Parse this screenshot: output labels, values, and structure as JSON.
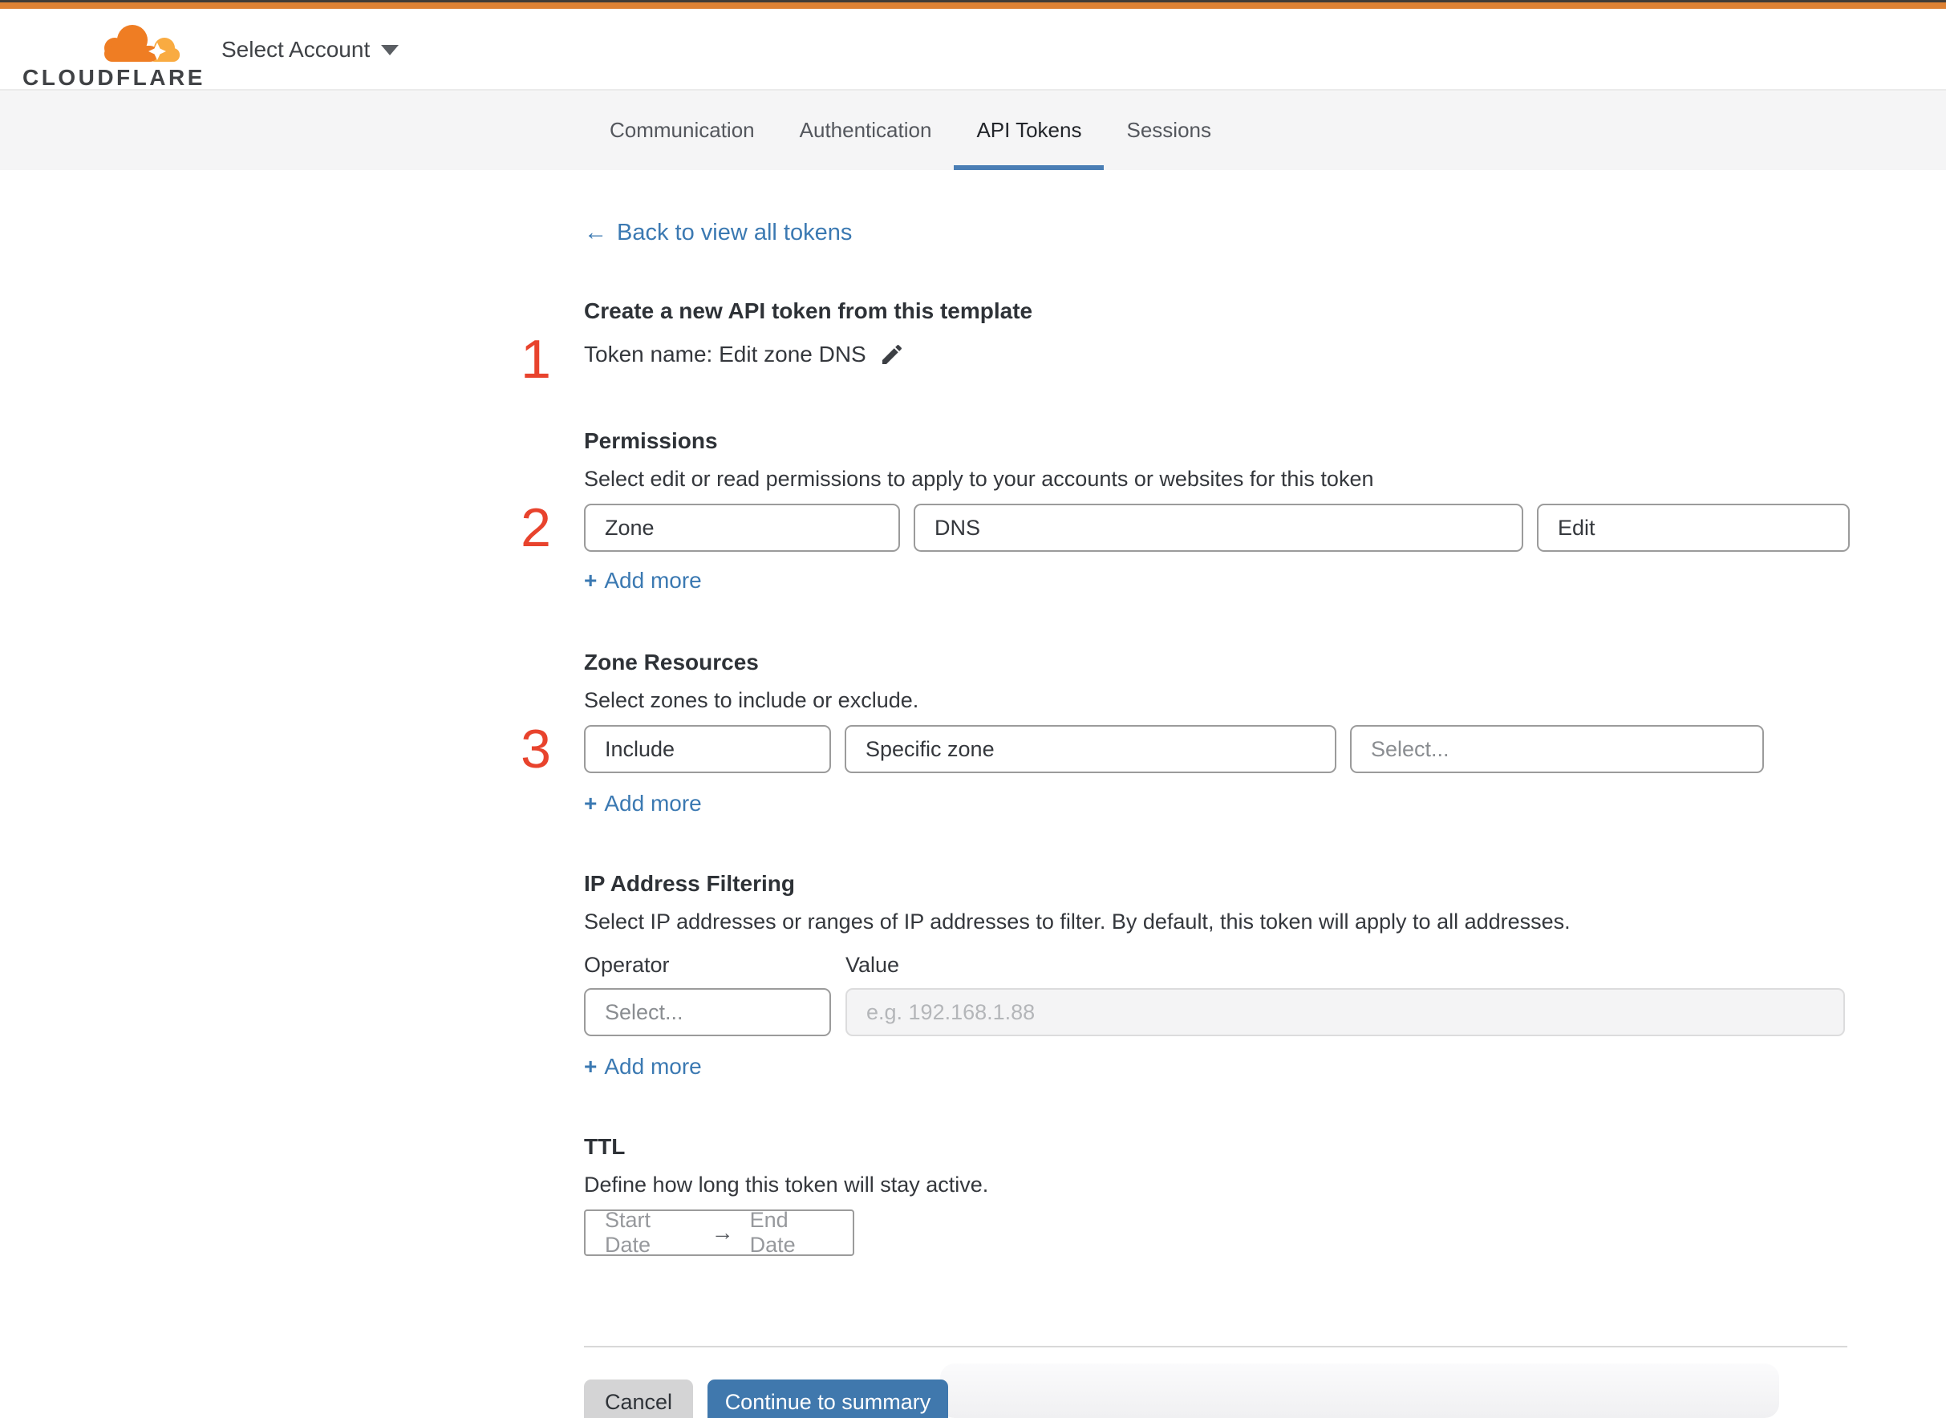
{
  "header": {
    "brand": "CLOUDFLARE",
    "account_selector": "Select Account"
  },
  "tabs": [
    {
      "label": "Communication",
      "active": false
    },
    {
      "label": "Authentication",
      "active": false
    },
    {
      "label": "API Tokens",
      "active": true
    },
    {
      "label": "Sessions",
      "active": false
    }
  ],
  "back": {
    "arrow": "←",
    "label": "Back to view all tokens"
  },
  "step1": {
    "number": "1",
    "heading": "Create a new API token from this template",
    "token_line": "Token name: Edit zone DNS"
  },
  "permissions": {
    "number": "2",
    "title": "Permissions",
    "description": "Select edit or read permissions to apply to your accounts or websites for this token",
    "type_value": "Zone",
    "item_value": "DNS",
    "level_value": "Edit"
  },
  "zone_resources": {
    "number": "3",
    "title": "Zone Resources",
    "description": "Select zones to include or exclude.",
    "mode_value": "Include",
    "scope_value": "Specific zone",
    "zone_placeholder": "Select..."
  },
  "ip_filtering": {
    "title": "IP Address Filtering",
    "description": "Select IP addresses or ranges of IP addresses to filter. By default, this token will apply to all addresses.",
    "operator_label": "Operator",
    "value_label": "Value",
    "operator_placeholder": "Select...",
    "value_placeholder": "e.g. 192.168.1.88"
  },
  "ttl": {
    "title": "TTL",
    "description": "Define how long this token will stay active.",
    "start_placeholder": "Start Date",
    "arrow": "→",
    "end_placeholder": "End Date"
  },
  "add_more": {
    "plus": "+",
    "label": "Add more"
  },
  "footer": {
    "cancel_label": "Cancel",
    "continue_label": "Continue to summary"
  },
  "colors": {
    "top_bar_orange": "#de8234",
    "brand_orange": "#ef7d23",
    "brand_orange_light": "#f9ab41",
    "link_blue": "#3b79b2",
    "button_blue": "#4078ad",
    "tab_underline_blue": "#4a7eb5",
    "step_number_red": "#e8432d"
  }
}
